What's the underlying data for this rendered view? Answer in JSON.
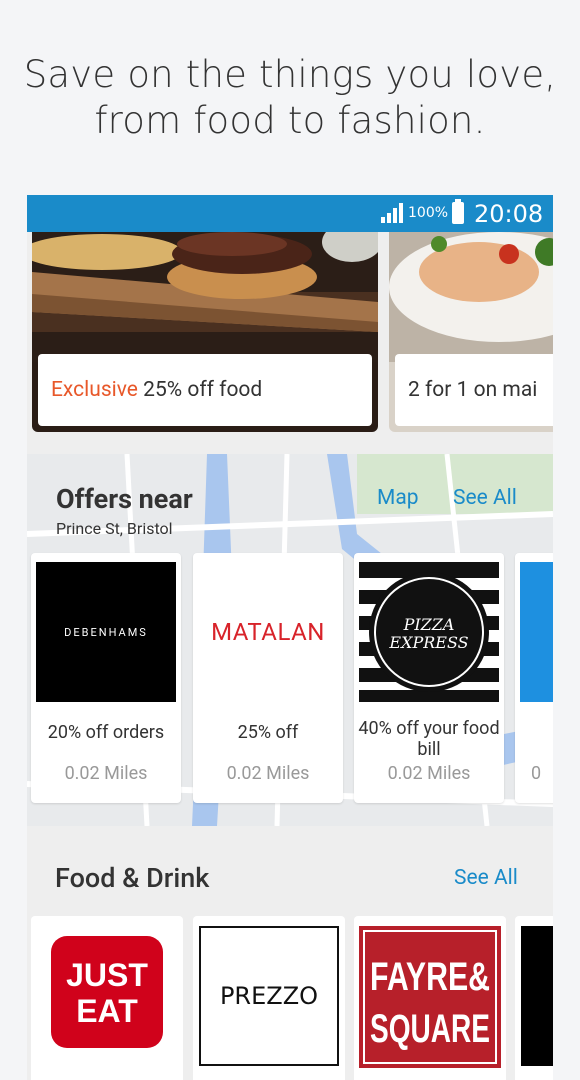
{
  "promo": {
    "line1": "Save on the things you love,",
    "line2": "from food to fashion."
  },
  "status_bar": {
    "battery": "100%",
    "time": "20:08",
    "color": "#1a8bc9"
  },
  "hero_cards": [
    {
      "accent": "Exclusive",
      "text": " 25% off food"
    },
    {
      "text": "2 for 1 on mai"
    }
  ],
  "offers_near": {
    "title": "Offers near",
    "location": "Prince St, Bristol",
    "map_link": "Map",
    "see_all": "See All",
    "items": [
      {
        "brand": "DEBENHAMS",
        "offer": "20% off orders",
        "distance": "0.02 Miles"
      },
      {
        "brand": "MATALAN",
        "offer": "25% off",
        "distance": "0.02 Miles"
      },
      {
        "brand": "PIZZA EXPRESS",
        "offer": "40% off your food bill",
        "distance": "0.02 Miles"
      },
      {
        "brand": "",
        "offer": "",
        "distance": "0"
      }
    ]
  },
  "food_drink": {
    "title": "Food & Drink",
    "see_all": "See All",
    "items": [
      {
        "brand": "JUST EAT",
        "logo_line1": "JUST",
        "logo_line2": "EAT"
      },
      {
        "brand": "PREZZO"
      },
      {
        "brand": "FAYRE & SQUARE",
        "logo_line1": "FAYRE&",
        "logo_line2": "SQUARE"
      },
      {
        "brand": ""
      }
    ]
  },
  "colors": {
    "accent_blue": "#1a8bc9",
    "exclusive_orange": "#e8582a",
    "matalan_red": "#d8232a",
    "just_eat_red": "#d0021b",
    "fayre_red": "#b7202a"
  }
}
